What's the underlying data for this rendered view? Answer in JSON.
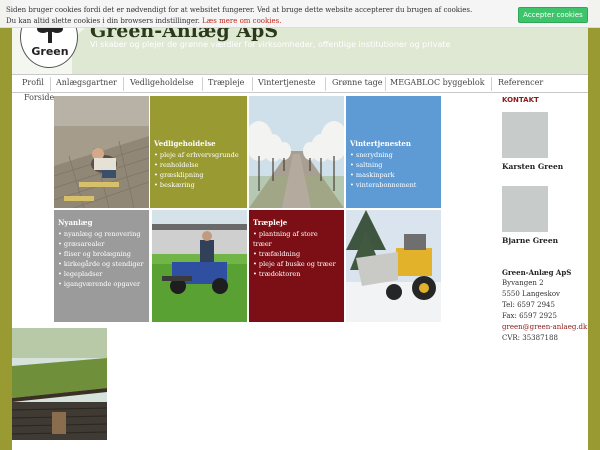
{
  "cookie": {
    "line1": "Siden bruger cookies fordi det er nødvendigt for at websitet fungerer. Ved at bruge dette website accepterer du brugen af cookies.",
    "line2": "Du kan altid slette cookies i din browsers indstillinger.",
    "link": "Læs mere om cookies.",
    "accept_label": "Accepter cookies"
  },
  "header": {
    "brand": "Green-Anlæg ApS",
    "tagline": "Vi skaber og plejer de grønne værdier for virksomheder, offentlige institutioner og private",
    "logo_text": "Green"
  },
  "nav": {
    "items": [
      "Profil",
      "Anlægsgartner",
      "Vedligeholdelse",
      "Træpleje",
      "Vintertjeneste",
      "Grønne tage",
      "MEGABLOC byggeblok",
      "Referencer",
      "Forside"
    ]
  },
  "tiles": {
    "vedligeholdelse": {
      "title": "Vedligeholdelse",
      "items": [
        "pleje af erhvervsgrunde",
        "renholdelse",
        "græsklipning",
        "beskæring"
      ]
    },
    "vintertjenesten": {
      "title": "Vintertjenesten",
      "items": [
        "snerydning",
        "saltning",
        "maskinpark",
        "vinterabonnement"
      ]
    },
    "nyanlaeg": {
      "title": "Nyanlæg",
      "items": [
        "nyanlæg og renovering",
        "græsarealer",
        "fliser og brolægning",
        "kirkegårde og stendiger",
        "legepladser",
        "igangværende opgaver"
      ]
    },
    "traepleje": {
      "title": "Træpleje",
      "items": [
        "plantning af store træer",
        "træfældning",
        "pleje af buske og træer",
        "trædoktoren"
      ]
    }
  },
  "colors": {
    "olive": "#9a9a33",
    "tile_olive": "#9a9a33",
    "tile_blue": "#5e9bd4",
    "tile_grey": "#9b9b9b",
    "tile_red": "#7c0f16",
    "accept_green": "#3ec46b",
    "contact_red": "#8b1a1a"
  },
  "sidebar": {
    "heading": "KONTAKT",
    "person1": "Karsten Green",
    "person2": "Bjarne Green",
    "company": "Green-Anlæg ApS",
    "address1": "Byvangen 2",
    "address2": "5550 Langeskov",
    "phone": "Tel: 6597 2945",
    "fax": "Fax: 6597 2925",
    "email": "green@green-anlaeg.dk",
    "cvr": "CVR: 35387188"
  }
}
